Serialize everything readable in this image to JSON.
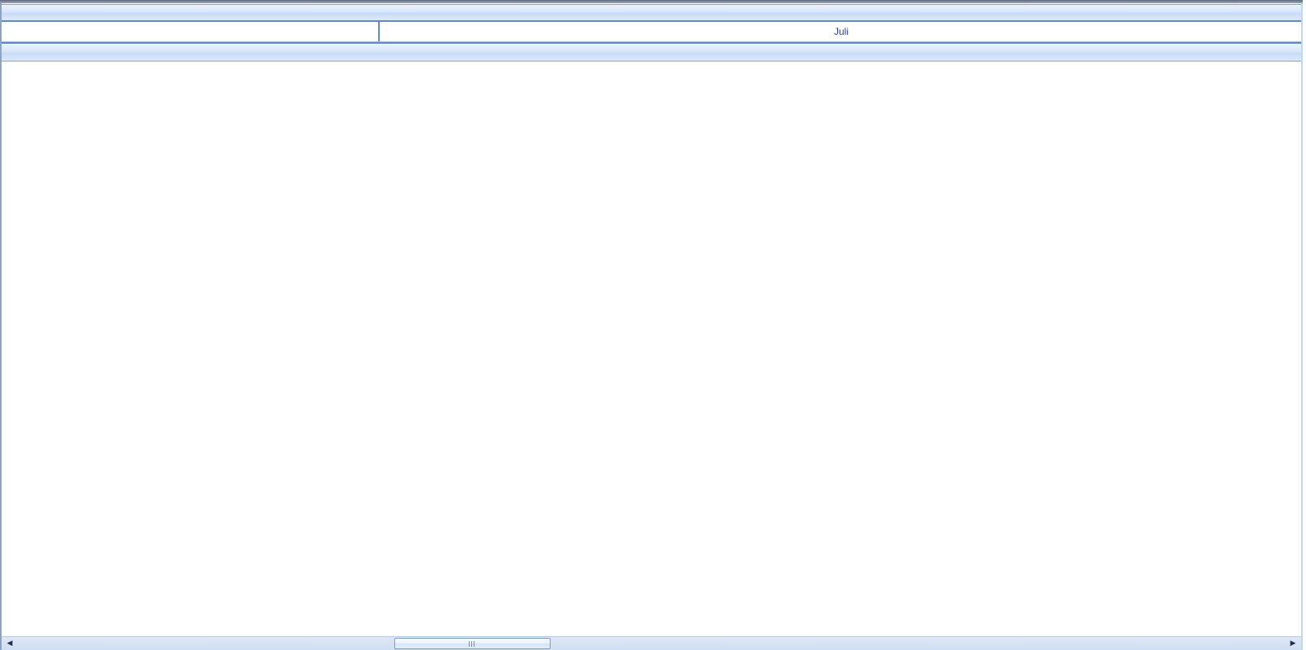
{
  "timeline": {
    "month_label": "Juli"
  },
  "scrollbar": {
    "left_arrow_glyph": "◀",
    "right_arrow_glyph": "▶"
  },
  "colors": {
    "header_band": "#d7e6fb",
    "border_accent": "#5f88c4",
    "month_text": "#2b3f8f"
  }
}
